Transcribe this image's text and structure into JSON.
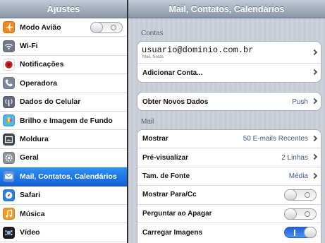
{
  "sidebar": {
    "title": "Ajustes",
    "items": [
      {
        "label": "Modo Avião",
        "icon": "airplane-icon",
        "color": "#f08a1d",
        "toggle": "off"
      },
      {
        "label": "Wi-Fi",
        "icon": "wifi-icon",
        "color": "#6d7a8c"
      },
      {
        "label": "Notificações",
        "icon": "notifications-icon",
        "color": "#d0231f"
      },
      {
        "label": "Operadora",
        "icon": "phone-icon",
        "color": "#7c8899"
      },
      {
        "label": "Dados do Celular",
        "icon": "cellular-icon",
        "color": "#5f6b7c"
      },
      {
        "label": "Brilho e Imagem de Fundo",
        "icon": "flower-icon",
        "color": "#4db6f0"
      },
      {
        "label": "Moldura",
        "icon": "picture-frame-icon",
        "color": "#3f4753"
      },
      {
        "label": "Geral",
        "icon": "gear-icon",
        "color": "#8a929d"
      },
      {
        "label": "Mail, Contatos, Calendários",
        "icon": "mail-icon",
        "color": "#5c8fe6",
        "selected": true
      },
      {
        "label": "Safari",
        "icon": "compass-icon",
        "color": "#2b7fe0"
      },
      {
        "label": "Música",
        "icon": "music-icon",
        "color": "#f39a22"
      },
      {
        "label": "Vídeo",
        "icon": "video-icon",
        "color": "#1c1c1c"
      }
    ]
  },
  "main": {
    "title": "Mail, Contatos, Calendários",
    "contas": {
      "label": "Contas",
      "account_email": "usuario@dominio.com.br",
      "account_sub": "Mail, Notas",
      "add_account": "Adicionar Conta..."
    },
    "fetch": {
      "label": "Obter Novos Dados",
      "value": "Push"
    },
    "mail": {
      "label": "Mail",
      "rows": [
        {
          "label": "Mostrar",
          "value": "50 E-mails Recentes",
          "kind": "chevron"
        },
        {
          "label": "Pré-visualizar",
          "value": "2 Linhas",
          "kind": "chevron"
        },
        {
          "label": "Tam. de Fonte",
          "value": "Média",
          "kind": "chevron"
        },
        {
          "label": "Mostrar Para/Cc",
          "kind": "toggle",
          "state": "off"
        },
        {
          "label": "Perguntar ao Apagar",
          "kind": "toggle",
          "state": "off"
        },
        {
          "label": "Carregar Imagens",
          "kind": "toggle",
          "state": "on"
        }
      ]
    }
  }
}
